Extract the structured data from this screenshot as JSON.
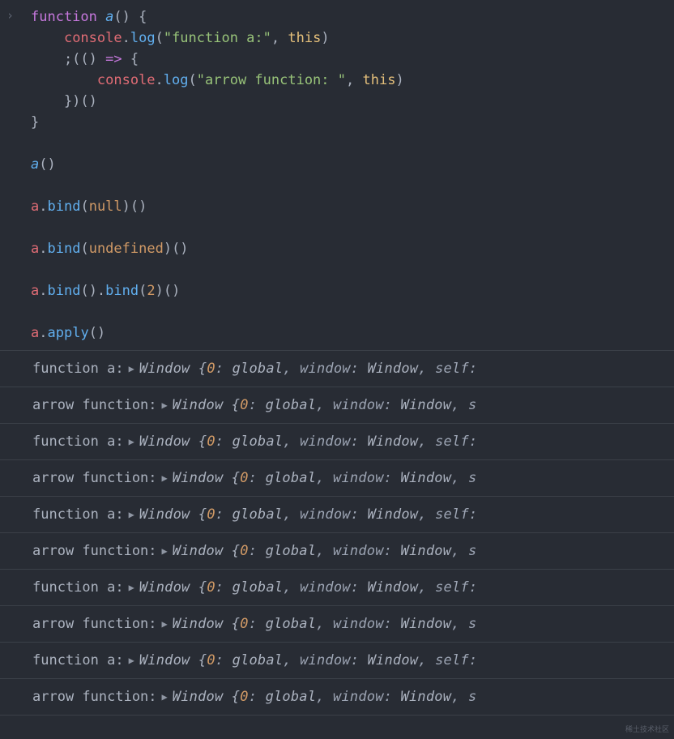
{
  "input": {
    "lines": [
      [
        {
          "t": "function ",
          "c": "kw"
        },
        {
          "t": "a",
          "c": "fn"
        },
        {
          "t": "() {",
          "c": "pl"
        }
      ],
      [
        {
          "t": "    ",
          "c": "pl"
        },
        {
          "t": "console",
          "c": "prop"
        },
        {
          "t": ".",
          "c": "pl"
        },
        {
          "t": "log",
          "c": "mth"
        },
        {
          "t": "(",
          "c": "pl"
        },
        {
          "t": "\"function a:\"",
          "c": "str"
        },
        {
          "t": ", ",
          "c": "pl"
        },
        {
          "t": "this",
          "c": "this"
        },
        {
          "t": ")",
          "c": "pl"
        }
      ],
      [
        {
          "t": "    ;(() ",
          "c": "pl"
        },
        {
          "t": "=>",
          "c": "arrow"
        },
        {
          "t": " {",
          "c": "pl"
        }
      ],
      [
        {
          "t": "        ",
          "c": "pl"
        },
        {
          "t": "console",
          "c": "prop"
        },
        {
          "t": ".",
          "c": "pl"
        },
        {
          "t": "log",
          "c": "mth"
        },
        {
          "t": "(",
          "c": "pl"
        },
        {
          "t": "\"arrow function: \"",
          "c": "str"
        },
        {
          "t": ", ",
          "c": "pl"
        },
        {
          "t": "this",
          "c": "this"
        },
        {
          "t": ")",
          "c": "pl"
        }
      ],
      [
        {
          "t": "    })()",
          "c": "pl"
        }
      ],
      [
        {
          "t": "}",
          "c": "pl"
        }
      ],
      [
        {
          "t": "",
          "c": "pl"
        }
      ],
      [
        {
          "t": "a",
          "c": "fn"
        },
        {
          "t": "()",
          "c": "pl"
        }
      ],
      [
        {
          "t": "",
          "c": "pl"
        }
      ],
      [
        {
          "t": "a",
          "c": "prop"
        },
        {
          "t": ".",
          "c": "pl"
        },
        {
          "t": "bind",
          "c": "mth"
        },
        {
          "t": "(",
          "c": "pl"
        },
        {
          "t": "null",
          "c": "null"
        },
        {
          "t": ")()",
          "c": "pl"
        }
      ],
      [
        {
          "t": "",
          "c": "pl"
        }
      ],
      [
        {
          "t": "a",
          "c": "prop"
        },
        {
          "t": ".",
          "c": "pl"
        },
        {
          "t": "bind",
          "c": "mth"
        },
        {
          "t": "(",
          "c": "pl"
        },
        {
          "t": "undefined",
          "c": "null"
        },
        {
          "t": ")()",
          "c": "pl"
        }
      ],
      [
        {
          "t": "",
          "c": "pl"
        }
      ],
      [
        {
          "t": "a",
          "c": "prop"
        },
        {
          "t": ".",
          "c": "pl"
        },
        {
          "t": "bind",
          "c": "mth"
        },
        {
          "t": "().",
          "c": "pl"
        },
        {
          "t": "bind",
          "c": "mth"
        },
        {
          "t": "(",
          "c": "pl"
        },
        {
          "t": "2",
          "c": "null"
        },
        {
          "t": ")()",
          "c": "pl"
        }
      ],
      [
        {
          "t": "",
          "c": "pl"
        }
      ],
      [
        {
          "t": "a",
          "c": "prop"
        },
        {
          "t": ".",
          "c": "pl"
        },
        {
          "t": "apply",
          "c": "mth"
        },
        {
          "t": "()",
          "c": "pl"
        }
      ]
    ]
  },
  "output": {
    "object_preview": {
      "type_name": "Window",
      "first_key": "0",
      "first_val": "global",
      "second_key": "window",
      "second_val": "Window",
      "third_key_a": "self:",
      "third_key_b": "s"
    },
    "rows": [
      {
        "label": "function a: ",
        "pad": 0,
        "tail": "a"
      },
      {
        "label": "arrow function:  ",
        "pad": 1,
        "tail": "b"
      },
      {
        "label": "function a: ",
        "pad": 0,
        "tail": "a"
      },
      {
        "label": "arrow function:  ",
        "pad": 1,
        "tail": "b"
      },
      {
        "label": "function a: ",
        "pad": 0,
        "tail": "a"
      },
      {
        "label": "arrow function:  ",
        "pad": 1,
        "tail": "b"
      },
      {
        "label": "function a: ",
        "pad": 0,
        "tail": "a"
      },
      {
        "label": "arrow function:  ",
        "pad": 1,
        "tail": "b"
      },
      {
        "label": "function a: ",
        "pad": 0,
        "tail": "a"
      },
      {
        "label": "arrow function:  ",
        "pad": 1,
        "tail": "b"
      }
    ]
  },
  "watermark_text": "稀土技术社区"
}
